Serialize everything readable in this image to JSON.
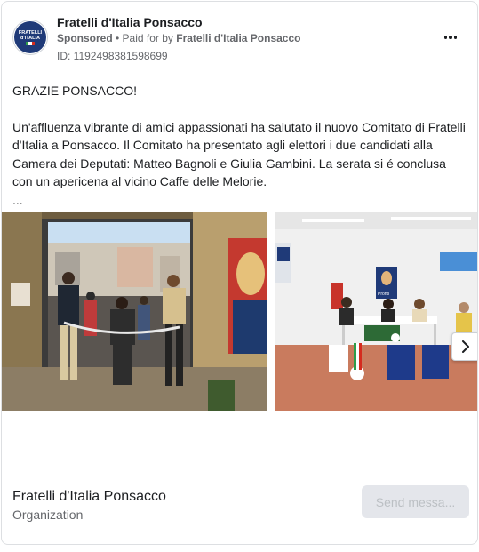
{
  "ad": {
    "page_name": "Fratelli d'Italia Ponsacco",
    "sponsored_label": "Sponsored",
    "paid_for_prefix": " • Paid for by ",
    "paid_for_by": "Fratelli d'Italia Ponsacco",
    "ad_id": "ID: 1192498381598699",
    "avatar_text_line1": "FRATELLI",
    "avatar_text_line2": "d'ITALIA",
    "more_icon": "more-dots-icon"
  },
  "body": {
    "line1": "GRAZIE PONSACCO!",
    "paragraph": "Un'affluenza vibrante di amici appassionati ha salutato il nuovo Comitato di Fratelli d'Italia a Ponsacco. Il Comitato ha presentato agli elettori i due candidati alla Camera dei Deputati: Matteo Bagnoli e Giulia Gambini. La serata si é conclusa con un apericena al vicino Caffe delle Melorie.",
    "ellipsis": "..."
  },
  "carousel": {
    "slides": [
      "slide-ribbon-cutting",
      "slide-committee-room"
    ],
    "poster_text": "Pronti",
    "next_icon": "chevron-right-icon"
  },
  "footer": {
    "page_name": "Fratelli d'Italia Ponsacco",
    "category": "Organization",
    "send_button_label": "Send messa..."
  },
  "colors": {
    "brand_blue": "#1f3a78",
    "muted_text": "#65676b",
    "disabled_button_bg": "#e4e6eb",
    "disabled_button_text": "#bcc0c4"
  }
}
